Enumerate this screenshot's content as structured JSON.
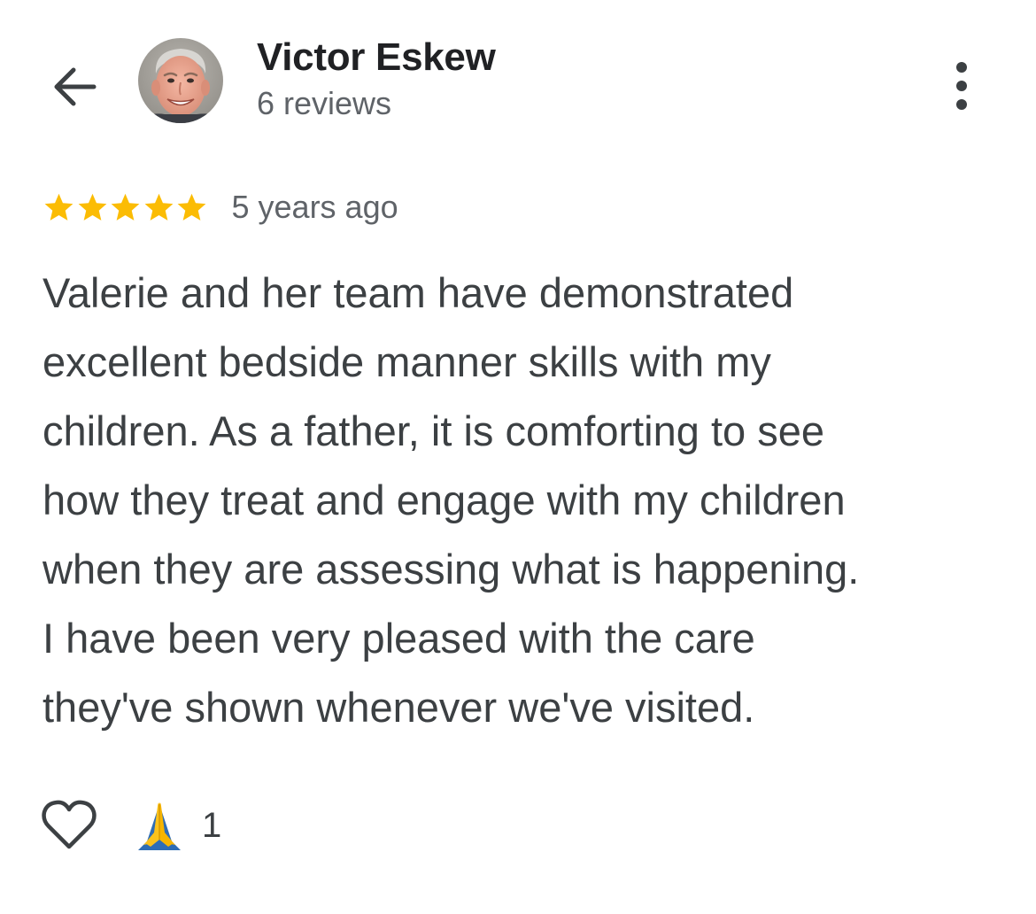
{
  "header": {
    "back_icon": "arrow-left-icon",
    "reviewer_name": "Victor Eskew",
    "review_count": "6 reviews",
    "more_icon": "more-vert-icon"
  },
  "review": {
    "rating": 5,
    "rating_max": 5,
    "star_color": "#fbbc04",
    "date": "5 years ago",
    "text_lines": [
      "Valerie and her team have demonstrated",
      "excellent bedside manner skills with my",
      "children. As a father, it is comforting to see",
      "how they treat and engage with my children",
      "when they are assessing what is happening.",
      "I have been very pleased with the care",
      "they've shown whenever we've visited."
    ]
  },
  "actions": {
    "like_icon": "heart-outline-icon",
    "reaction_icon": "folded-hands-emoji-icon",
    "reaction_count": "1"
  }
}
